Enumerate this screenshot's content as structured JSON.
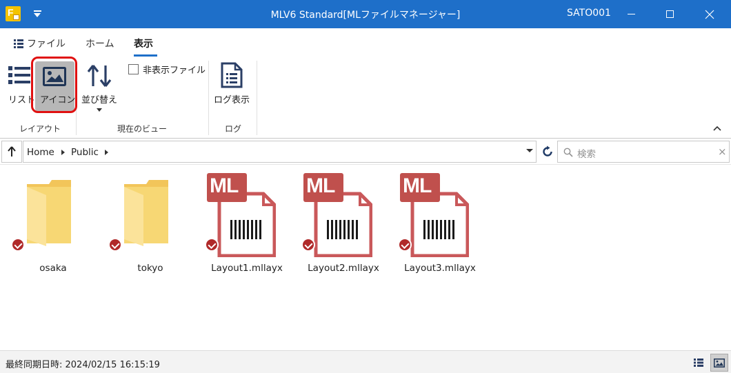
{
  "titlebar": {
    "app_icon": "mlv-file-manager-icon",
    "title": "MLV6 Standard[MLファイルマネージャー]",
    "user": "SATO001"
  },
  "ribbon": {
    "tabs": [
      {
        "label": "ファイル",
        "icon": "list-icon"
      },
      {
        "label": "ホーム"
      },
      {
        "label": "表示",
        "active": true
      }
    ],
    "groups": {
      "layout": {
        "label": "レイアウト",
        "list_label": "リスト",
        "icon_label": "アイコン"
      },
      "current_view": {
        "label": "現在のビュー",
        "sort_label": "並び替え",
        "hidden_files_label": "非表示ファイル",
        "hidden_files_checked": false
      },
      "log": {
        "label": "ログ",
        "show_log_label": "ログ表示"
      }
    }
  },
  "address": {
    "breadcrumb": [
      "Home",
      "Public"
    ],
    "search_placeholder": "検索",
    "clear_symbol": "×"
  },
  "files": [
    {
      "name": "osaka",
      "type": "folder",
      "synced": true
    },
    {
      "name": "tokyo",
      "type": "folder",
      "synced": true
    },
    {
      "name": "Layout1.mllayx",
      "type": "mllayx",
      "badge": "ML",
      "synced": true
    },
    {
      "name": "Layout2.mllayx",
      "type": "mllayx",
      "badge": "ML",
      "synced": true
    },
    {
      "name": "Layout3.mllayx",
      "type": "mllayx",
      "badge": "ML",
      "synced": true
    }
  ],
  "status": {
    "last_sync": "最終同期日時: 2024/02/15 16:15:19"
  },
  "colors": {
    "titlebar": "#1e6fc9",
    "accent": "#1e6fc9",
    "folder": "#f7d774",
    "mllayx": "#c0504d",
    "sync_badge": "#b02a2a",
    "highlight": "#e01010"
  }
}
